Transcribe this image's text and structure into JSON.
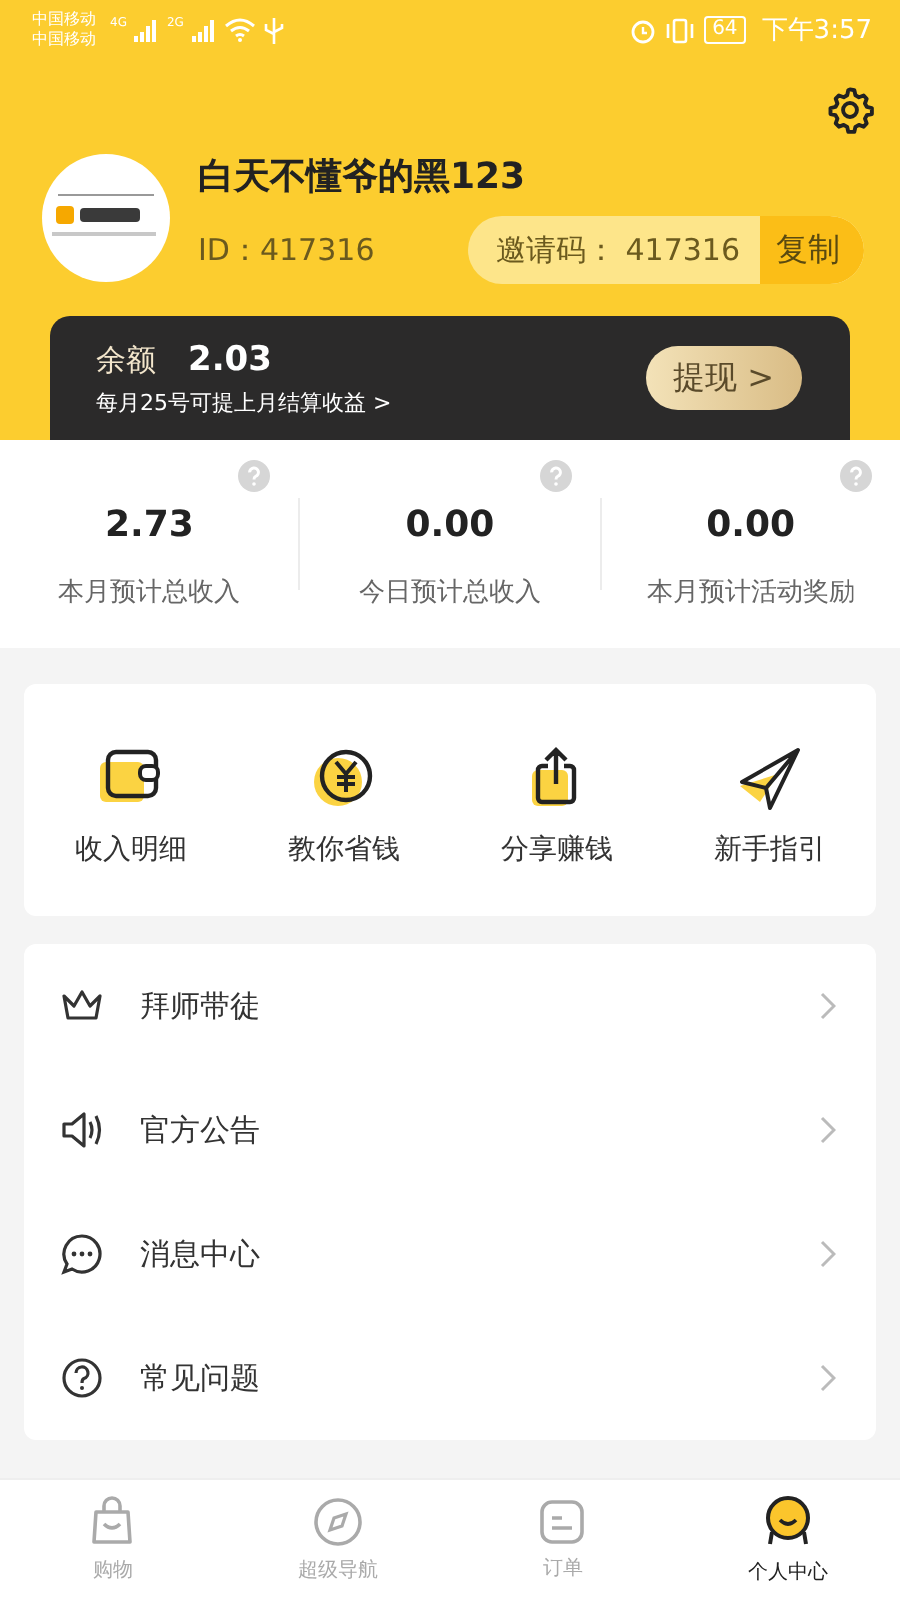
{
  "status_bar": {
    "carriers": [
      "中国移动",
      "中国移动"
    ],
    "networks": [
      "4G",
      "2G"
    ],
    "battery": "64",
    "time": "下午3:57"
  },
  "profile": {
    "name": "白天不懂爷的黑123",
    "id_label": "ID：417316",
    "invite_label": "邀请码：",
    "invite_code": "417316",
    "copy_button": "复制"
  },
  "balance": {
    "label": "余额",
    "amount": "2.03",
    "note": "每月25号可提上月结算收益 >",
    "withdraw_button": "提现 >"
  },
  "stats": [
    {
      "value": "2.73",
      "label": "本月预计总收入"
    },
    {
      "value": "0.00",
      "label": "今日预计总收入"
    },
    {
      "value": "0.00",
      "label": "本月预计活动奖励"
    }
  ],
  "shortcuts": [
    {
      "kind": "wallet",
      "label": "收入明细"
    },
    {
      "kind": "coin",
      "label": "教你省钱"
    },
    {
      "kind": "share",
      "label": "分享赚钱"
    },
    {
      "kind": "plane",
      "label": "新手指引"
    }
  ],
  "menu": [
    {
      "kind": "crown",
      "label": "拜师带徒"
    },
    {
      "kind": "speaker",
      "label": "官方公告"
    },
    {
      "kind": "chat",
      "label": "消息中心"
    },
    {
      "kind": "question",
      "label": "常见问题"
    }
  ],
  "tab_bar": [
    {
      "kind": "bag",
      "label": "购物",
      "selected": false
    },
    {
      "kind": "compass",
      "label": "超级导航",
      "selected": false
    },
    {
      "kind": "order",
      "label": "订单",
      "selected": false
    },
    {
      "kind": "me",
      "label": "个人中心",
      "selected": true
    }
  ]
}
